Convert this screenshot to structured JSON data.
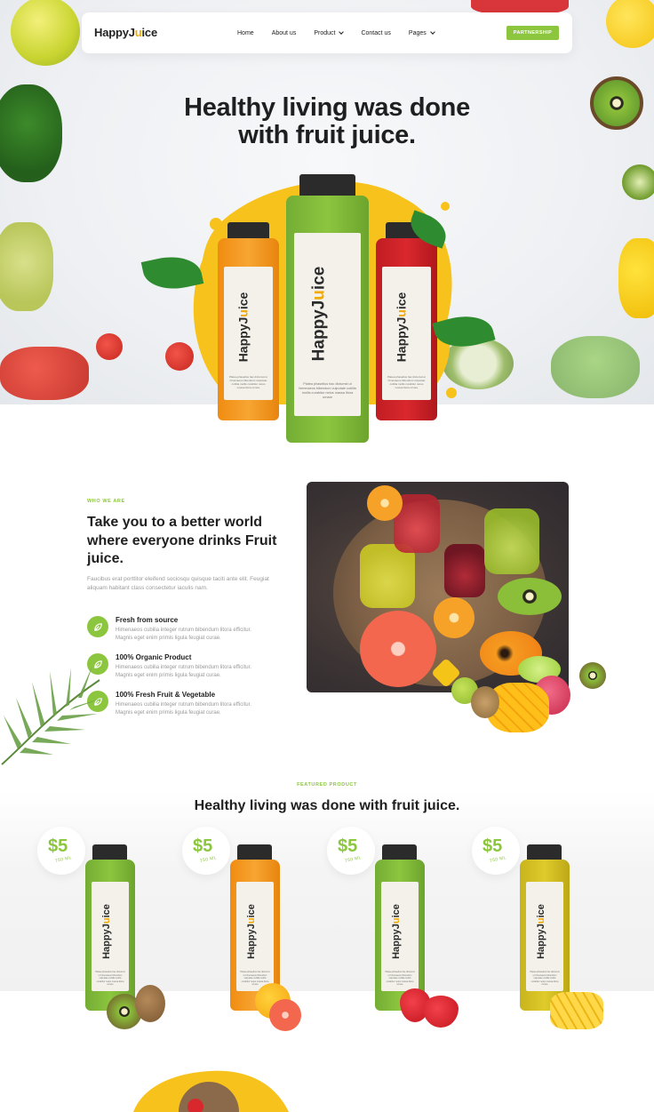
{
  "brand": {
    "name_left": "HappyJ",
    "name_accent": "u",
    "name_right": "ice"
  },
  "nav": {
    "items": [
      {
        "label": "Home",
        "has_dropdown": false
      },
      {
        "label": "About us",
        "has_dropdown": false
      },
      {
        "label": "Product",
        "has_dropdown": true
      },
      {
        "label": "Contact us",
        "has_dropdown": false
      },
      {
        "label": "Pages",
        "has_dropdown": true
      }
    ],
    "cta_label": "PARTNERSHIP"
  },
  "hero": {
    "title_line1": "Healthy living was done",
    "title_line2": "with fruit juice.",
    "bottle_label_text": "Platea phasellus hac dictumst ut himenaeos bibendum vulputate cubilia mollis curabitur netus massa litora ornare"
  },
  "about": {
    "eyebrow": "WHO WE ARE",
    "title": "Take you to a better world where everyone drinks Fruit juice.",
    "description": "Faucibus erat porttitor eleifend sociosqu quisque taciti ante elit. Feugiat aliquam habitant class consectetur iaculis nam.",
    "features": [
      {
        "title": "Fresh from source",
        "desc": "Himenaeos cubilia integer rutrum bibendum litora efficitur. Magnis eget enim primis ligula feugiat curae.",
        "icon": "leaf-icon"
      },
      {
        "title": "100% Organic Product",
        "desc": "Himenaeos cubilia integer rutrum bibendum litora efficitur. Magnis eget enim primis ligula feugiat curae.",
        "icon": "leaf-icon"
      },
      {
        "title": "100% Fresh Fruit & Vegetable",
        "desc": "Himenaeos cubilia integer rutrum bibendum litora efficitur. Magnis eget enim primis ligula feugiat curae.",
        "icon": "leaf-icon"
      }
    ]
  },
  "featured": {
    "eyebrow": "FEATURED PRODUCT",
    "title": "Healthy living was done with fruit juice.",
    "products": [
      {
        "price": "$5",
        "volume": "750 ML",
        "juice_color": "#7fb53a",
        "fruit": "kiwi"
      },
      {
        "price": "$5",
        "volume": "750 ML",
        "juice_color": "#f39a1e",
        "fruit": "orange-grapefruit"
      },
      {
        "price": "$5",
        "volume": "750 ML",
        "juice_color": "#7fb53a",
        "fruit": "strawberry"
      },
      {
        "price": "$5",
        "volume": "750 ML",
        "juice_color": "#d8c226",
        "fruit": "pineapple"
      }
    ]
  },
  "colors": {
    "accent": "#8cc63f",
    "logo_accent": "#f2a900",
    "splash": "#f7c21b",
    "text_dark": "#1f1f1f"
  }
}
